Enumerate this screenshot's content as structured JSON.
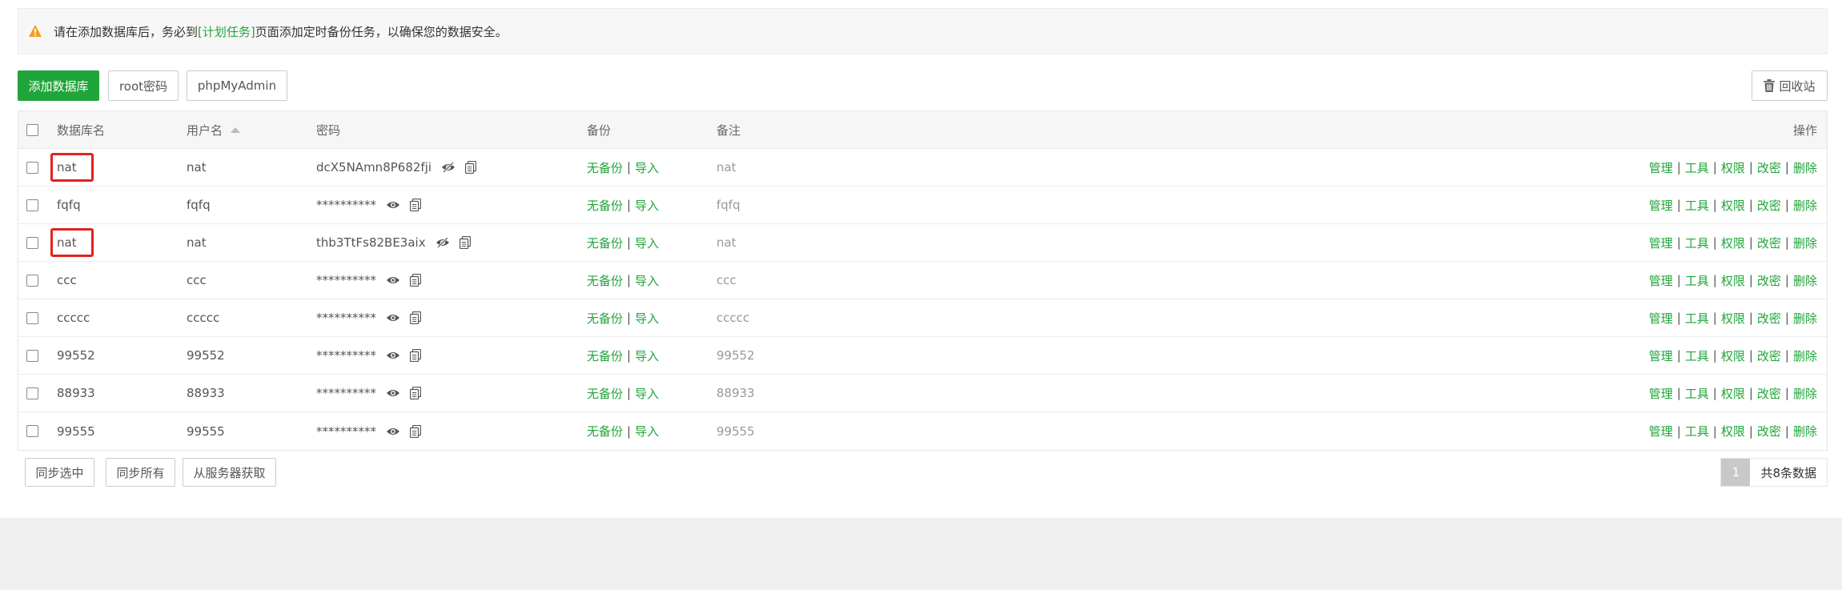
{
  "notice": {
    "prefix": "请在添加数据库后，务必到",
    "link": "[计划任务]",
    "suffix": "页面添加定时备份任务，以确保您的数据安全。"
  },
  "toolbar": {
    "add_db": "添加数据库",
    "root_password": "root密码",
    "phpmyadmin": "phpMyAdmin",
    "recycle_bin": "回收站"
  },
  "table": {
    "headers": {
      "name": "数据库名",
      "user": "用户名",
      "password": "密码",
      "backup": "备份",
      "note": "备注",
      "ops": "操作"
    },
    "backup_none": "无备份",
    "import": "导入",
    "ops": {
      "manage": "管理",
      "tools": "工具",
      "perms": "权限",
      "change_pw": "改密",
      "delete": "删除"
    },
    "rows": [
      {
        "name": "nat",
        "user": "nat",
        "password": "dcX5NAmn8P682fji",
        "note": "nat"
      },
      {
        "name": "fqfq",
        "user": "fqfq",
        "password": "**********",
        "note": "fqfq"
      },
      {
        "name": "nat",
        "user": "nat",
        "password": "thb3TtFs82BE3aix",
        "note": "nat"
      },
      {
        "name": "ccc",
        "user": "ccc",
        "password": "**********",
        "note": "ccc"
      },
      {
        "name": "ccccc",
        "user": "ccccc",
        "password": "**********",
        "note": "ccccc"
      },
      {
        "name": "99552",
        "user": "99552",
        "password": "**********",
        "note": "99552"
      },
      {
        "name": "88933",
        "user": "88933",
        "password": "**********",
        "note": "88933"
      },
      {
        "name": "99555",
        "user": "99555",
        "password": "**********",
        "note": "99555"
      }
    ]
  },
  "footer": {
    "sync_selected": "同步选中",
    "sync_all": "同步所有",
    "fetch_server": "从服务器获取",
    "page": "1",
    "total": "共8条数据"
  },
  "colors": {
    "accent": "#20a53a",
    "highlight": "#e0231e",
    "warning": "#f0a020"
  },
  "icons": {
    "warning": "warning-icon",
    "trash": "trash-icon",
    "eye": "eye-icon",
    "eye_slash": "eye-slash-icon",
    "copy": "copy-icon",
    "sort_up": "sort-up-icon"
  }
}
